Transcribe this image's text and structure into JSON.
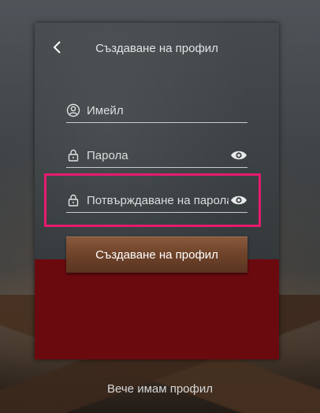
{
  "header": {
    "back_icon": "chevron-left-icon",
    "title": "Създаване на профил"
  },
  "form": {
    "email": {
      "placeholder": "Имейл",
      "value": "",
      "icon": "user-circle-icon"
    },
    "password": {
      "placeholder": "Парола",
      "value": "",
      "icon": "lock-icon",
      "toggle_icon": "eye-icon"
    },
    "confirm_password": {
      "placeholder": "Потвърждаване на парола",
      "value": "",
      "icon": "lock-icon",
      "toggle_icon": "eye-icon"
    },
    "submit_label": "Създаване на профил"
  },
  "footer": {
    "have_account_label": "Вече имам профил"
  },
  "colors": {
    "highlight": "#e61b6e",
    "panel": "#3b4043",
    "blood": "#6a0a0f",
    "button": "#6e4329"
  }
}
